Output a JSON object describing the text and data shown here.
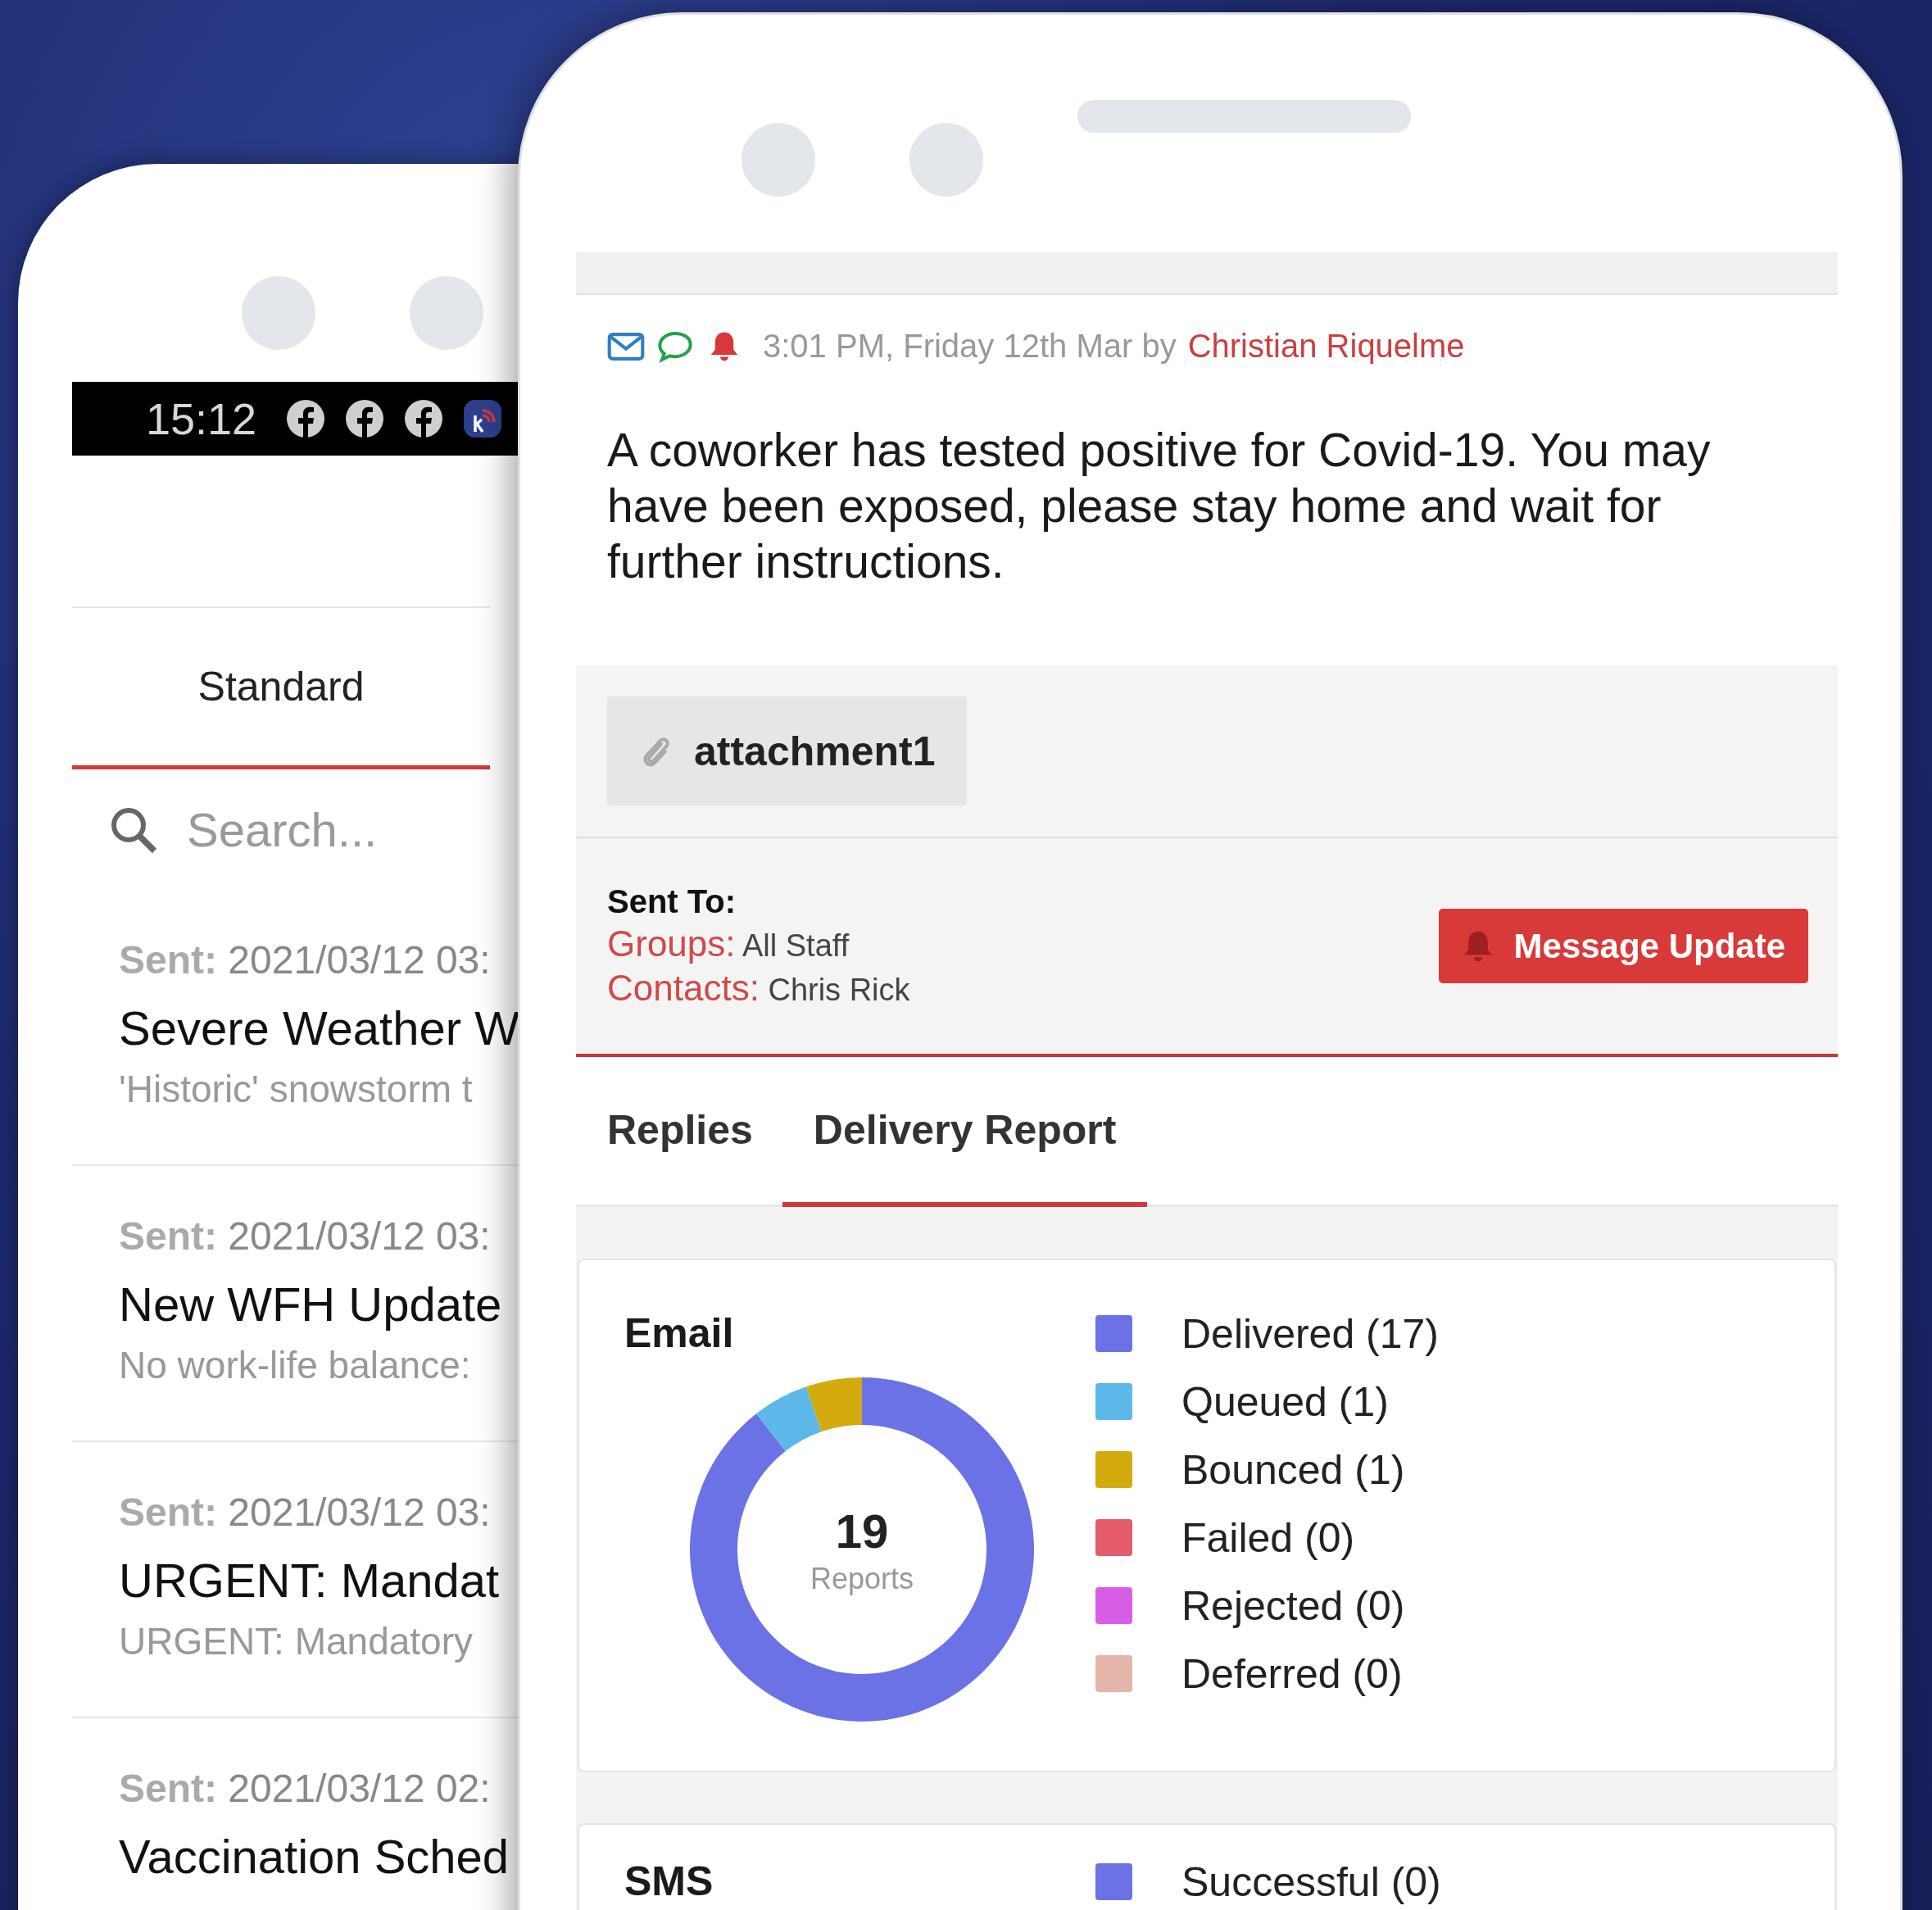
{
  "back_phone": {
    "status_bar": {
      "time": "15:12"
    },
    "tabs": [
      {
        "label": "Standard",
        "selected": true
      }
    ],
    "search": {
      "placeholder": "Search..."
    },
    "messages": [
      {
        "sent_label": "Sent:",
        "sent": "2021/03/12 03:",
        "title": "Severe Weather W",
        "preview": "'Historic' snowstorm t"
      },
      {
        "sent_label": "Sent:",
        "sent": "2021/03/12 03:",
        "title": "New WFH Update",
        "preview": "No work-life balance:"
      },
      {
        "sent_label": "Sent:",
        "sent": "2021/03/12 03:",
        "title": "URGENT: Mandat",
        "preview": "URGENT: Mandatory"
      },
      {
        "sent_label": "Sent:",
        "sent": "2021/03/12 02:",
        "title": "Vaccination Sched"
      }
    ]
  },
  "front_phone": {
    "meta": {
      "time": "3:01 PM, Friday 12th Mar by",
      "author": "Christian Riquelme"
    },
    "message": "A coworker has tested positive for Covid-19. You may have been exposed, please stay home and wait for further instructions.",
    "attachment": "attachment1",
    "sent_to": {
      "heading": "Sent To:",
      "groups_label": "Groups:",
      "groups": "All Staff",
      "contacts_label": "Contacts:",
      "contacts": "Chris Rick"
    },
    "button": "Message Update",
    "tabs": [
      {
        "label": "Replies",
        "selected": false
      },
      {
        "label": "Delivery Report",
        "selected": true
      }
    ],
    "email_card": {
      "title": "Email",
      "total": "19",
      "total_label": "Reports",
      "legend": [
        {
          "count": "(17)",
          "color": "#6a72e6"
        },
        {
          "count": "(1)",
          "color": "#5cb8e8"
        },
        {
          "count": "(1)",
          "color": "#d4ab0e"
        },
        {
          "count": "(0)",
          "color": "#e45b6c"
        },
        {
          "count": "(0)",
          "color": "#d85ee8"
        },
        {
          "count": "(0)",
          "color": "#e6b5aa"
        }
      ],
      "chart_data": {
        "type": "donut",
        "categories": [
          "Delivered",
          "Queued",
          "Bounced",
          "Failed",
          "Rejected",
          "Deferred"
        ],
        "values": [
          89.48,
          5.26,
          5.26,
          0,
          0,
          0
        ]
      }
    },
    "sms_card": {
      "title": "SMS",
      "legend": [
        {
          "label": "Successful (0)",
          "color": "#6a72e6"
        }
      ]
    }
  }
}
